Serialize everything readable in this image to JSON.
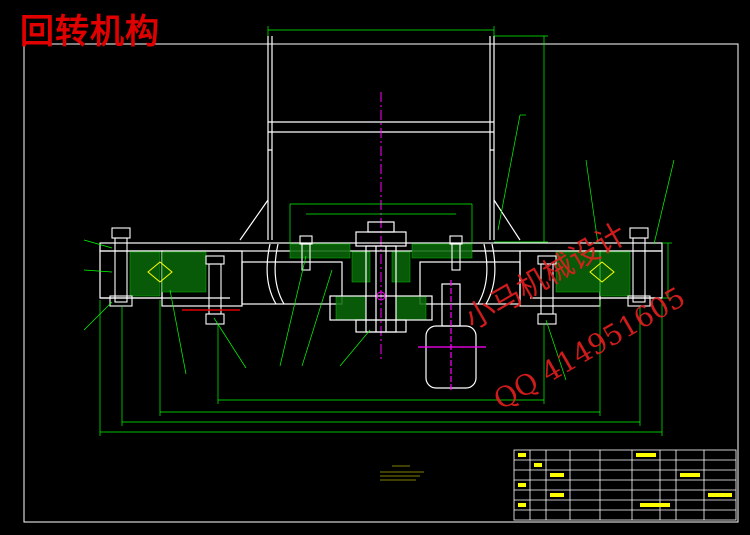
{
  "drawing": {
    "title": "回转机构",
    "watermark_line1": "小马机械设计",
    "watermark_line2": "QQ 414951605"
  },
  "colors": {
    "background": "#000000",
    "title_red": "#e00000",
    "outline_white": "#ffffff",
    "dim_green": "#00ff00",
    "centerline_magenta": "#ff00ff",
    "accent_yellow": "#ffff00",
    "hatch_green": "#00c800"
  }
}
